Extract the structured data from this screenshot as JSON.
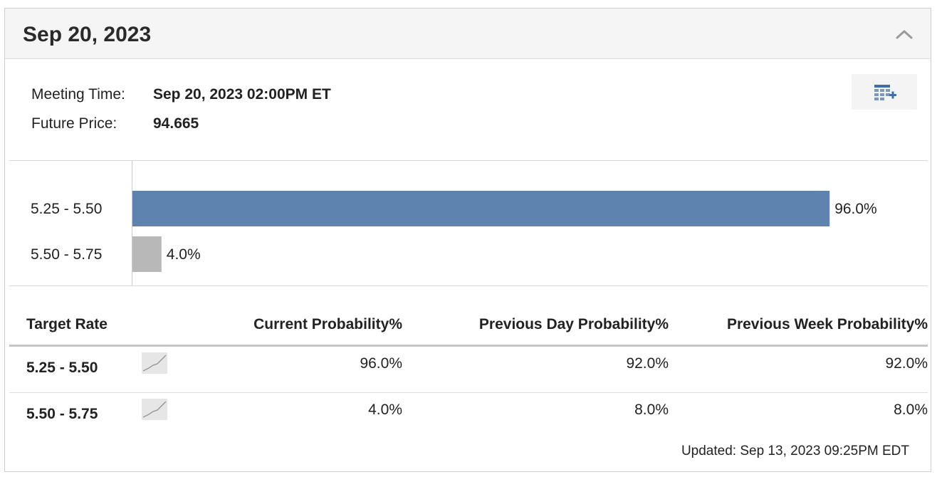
{
  "header": {
    "title": "Sep 20, 2023",
    "collapse_icon": "chevron-up-icon"
  },
  "meta": {
    "meeting_time_label": "Meeting Time:",
    "meeting_time_value": "Sep 20, 2023 02:00PM ET",
    "future_price_label": "Future Price:",
    "future_price_value": "94.665"
  },
  "export_button": {
    "icon": "table-add-icon"
  },
  "chart_data": {
    "type": "bar",
    "orientation": "horizontal",
    "categories": [
      "5.25 - 5.50",
      "5.50 - 5.75"
    ],
    "values": [
      96.0,
      4.0
    ],
    "value_labels": [
      "96.0%",
      "4.0%"
    ],
    "colors": [
      "#5d83ae",
      "#b8b8b8"
    ],
    "xlim": [
      0,
      100
    ]
  },
  "table": {
    "headers": [
      "Target Rate",
      "Current Probability%",
      "Previous Day Probability%",
      "Previous Week Probability%"
    ],
    "rows": [
      {
        "rate": "5.25 - 5.50",
        "current": "96.0%",
        "prev_day": "92.0%",
        "prev_week": "92.0%"
      },
      {
        "rate": "5.50 - 5.75",
        "current": "4.0%",
        "prev_day": "8.0%",
        "prev_week": "8.0%"
      }
    ],
    "trend_icon": "trend-chart-icon"
  },
  "footer": {
    "updated": "Updated: Sep 13, 2023 09:25PM EDT"
  }
}
